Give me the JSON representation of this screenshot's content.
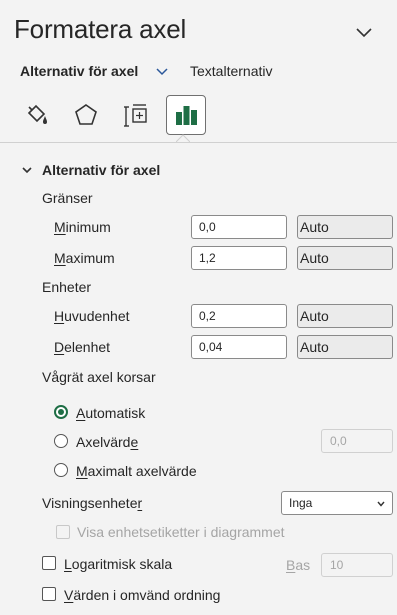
{
  "pane": {
    "title": "Formatera axel",
    "collapse_icon": "chevron-down-icon"
  },
  "subtabs": {
    "active": "Alternativ för axel",
    "other": "Textalternativ"
  },
  "icon_tabs": [
    {
      "name": "fill-line-icon"
    },
    {
      "name": "effects-pentagon-icon"
    },
    {
      "name": "size-properties-icon"
    },
    {
      "name": "axis-options-bar-chart-icon",
      "active": true
    }
  ],
  "colors": {
    "accent": "#1e6e45",
    "background": "#f3f3f3"
  },
  "section": {
    "title": "Alternativ för axel",
    "bounds": {
      "heading": "Gränser",
      "minimum": {
        "label_u": "M",
        "label_rest": "inimum",
        "value": "0,0",
        "auto": "Auto"
      },
      "maximum": {
        "label_u": "M",
        "label_rest": "aximum",
        "value": "1,2",
        "auto": "Auto"
      }
    },
    "units": {
      "heading": "Enheter",
      "major": {
        "label_u": "H",
        "label_rest": "uvudenhet",
        "value": "0,2",
        "auto": "Auto"
      },
      "minor": {
        "label_u": "D",
        "label_rest": "elenhet",
        "value": "0,04",
        "auto": "Auto"
      }
    },
    "crosses": {
      "heading": "Vågrät axel korsar",
      "automatic": {
        "label_u": "A",
        "label_rest": "utomatisk",
        "selected": true
      },
      "axis_value": {
        "label_pre": "Axelvärd",
        "label_u": "e",
        "label_rest": "",
        "value": "0,0",
        "selected": false
      },
      "max_axis_value": {
        "label_u": "M",
        "label_rest": "aximalt axelvärde",
        "selected": false
      }
    },
    "display_units": {
      "label_pre": "Visningsenhete",
      "label_u": "r",
      "label_rest": "",
      "selected": "Inga",
      "show_label": "Visa enhetsetiketter i diagrammet",
      "show_label_checked": false
    },
    "log_scale": {
      "label_u": "L",
      "label_rest": "ogaritmisk skala",
      "checked": false,
      "base_label_u": "B",
      "base_label_rest": "as",
      "base_value": "10"
    },
    "reverse": {
      "label_u": "V",
      "label_rest": "ärden i omvänd ordning",
      "checked": false
    }
  }
}
